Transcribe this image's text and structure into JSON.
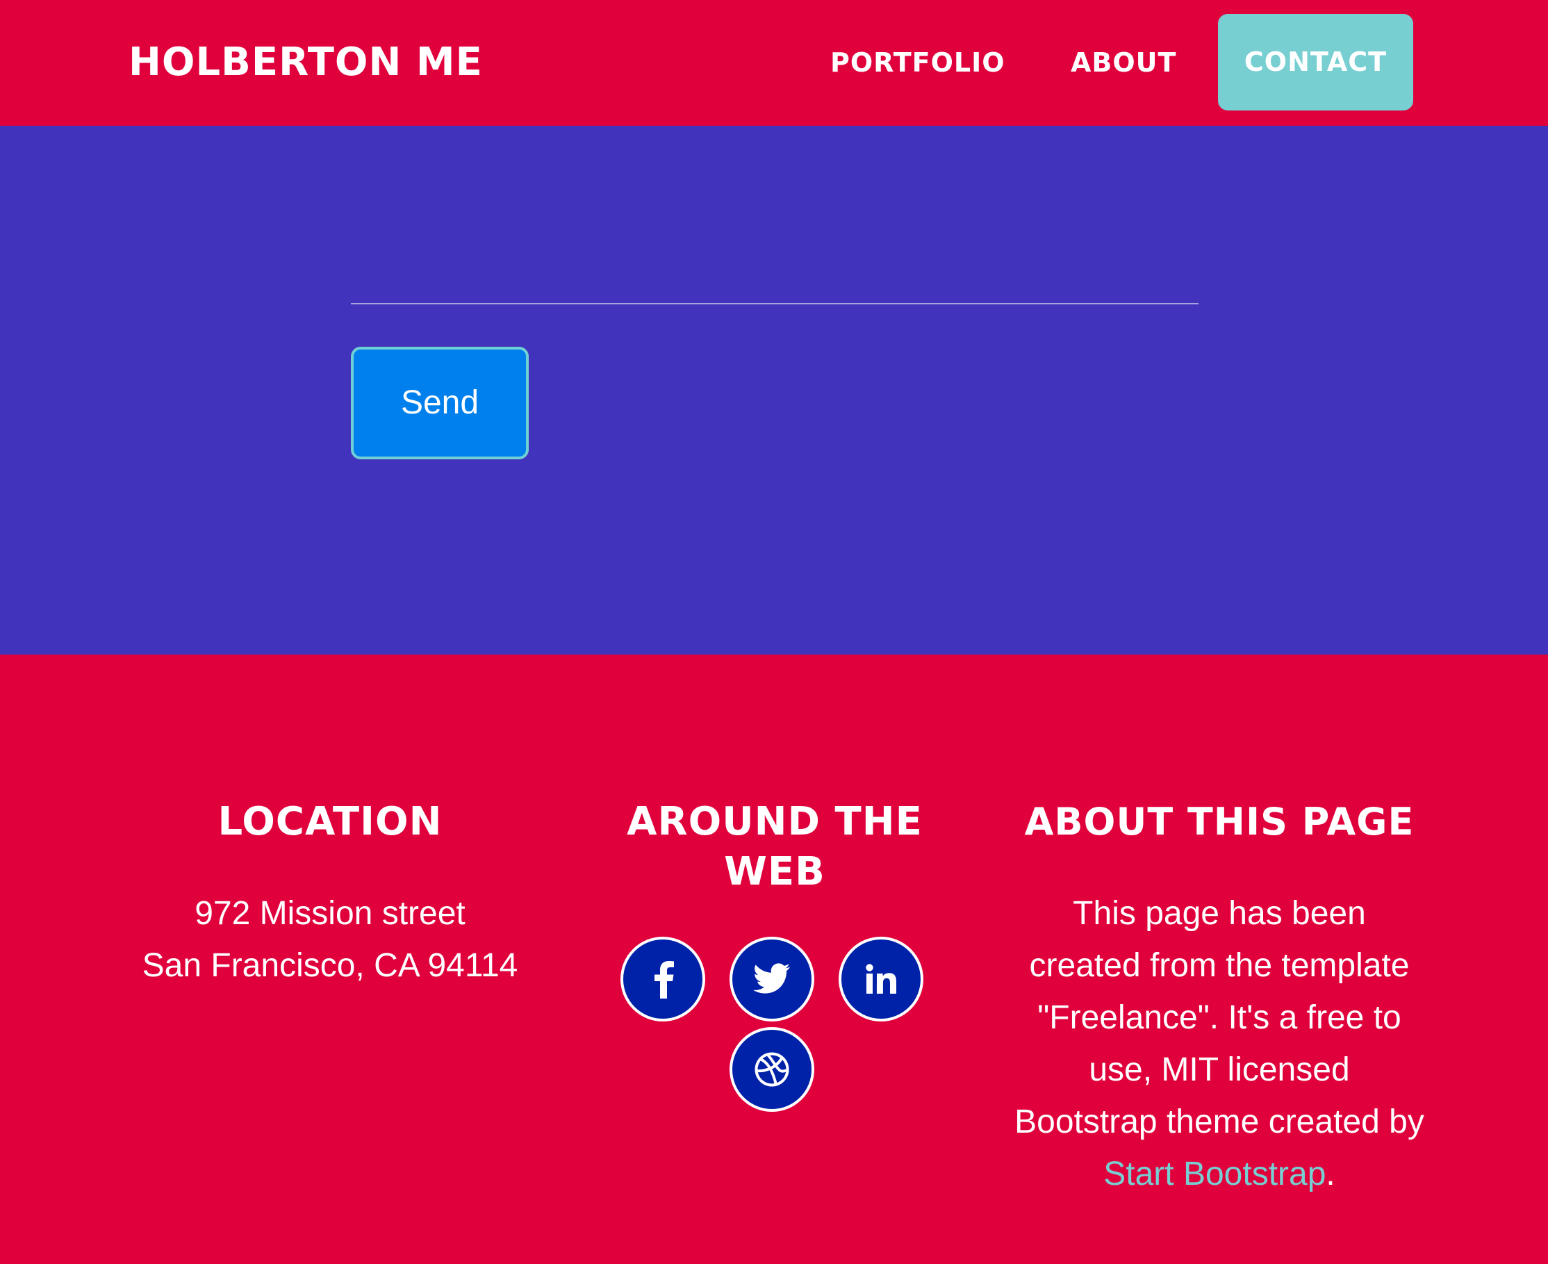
{
  "nav": {
    "brand": "HOLBERTON ME",
    "items": [
      "PORTFOLIO",
      "ABOUT",
      "CONTACT"
    ]
  },
  "contact": {
    "send_label": "Send"
  },
  "footer": {
    "location": {
      "heading": "LOCATION",
      "line1": "972 Mission street",
      "line2": "San Francisco, CA 94114"
    },
    "web": {
      "heading": "AROUND THE WEB",
      "links": [
        "facebook-icon",
        "twitter-icon",
        "linkedin-icon",
        "dribbble-icon"
      ]
    },
    "about": {
      "heading": "ABOUT THIS PAGE",
      "text": "This page has been created from the template \"Freelance\". It's a free to use, MIT licensed Bootstrap theme created by",
      "link_text": "Start Bootstrap",
      "end": "."
    }
  },
  "colors": {
    "primary": "#e0003c",
    "section": "#4233bd",
    "accent": "#78cfd2",
    "button": "#0080ec",
    "social": "#0022a8"
  }
}
